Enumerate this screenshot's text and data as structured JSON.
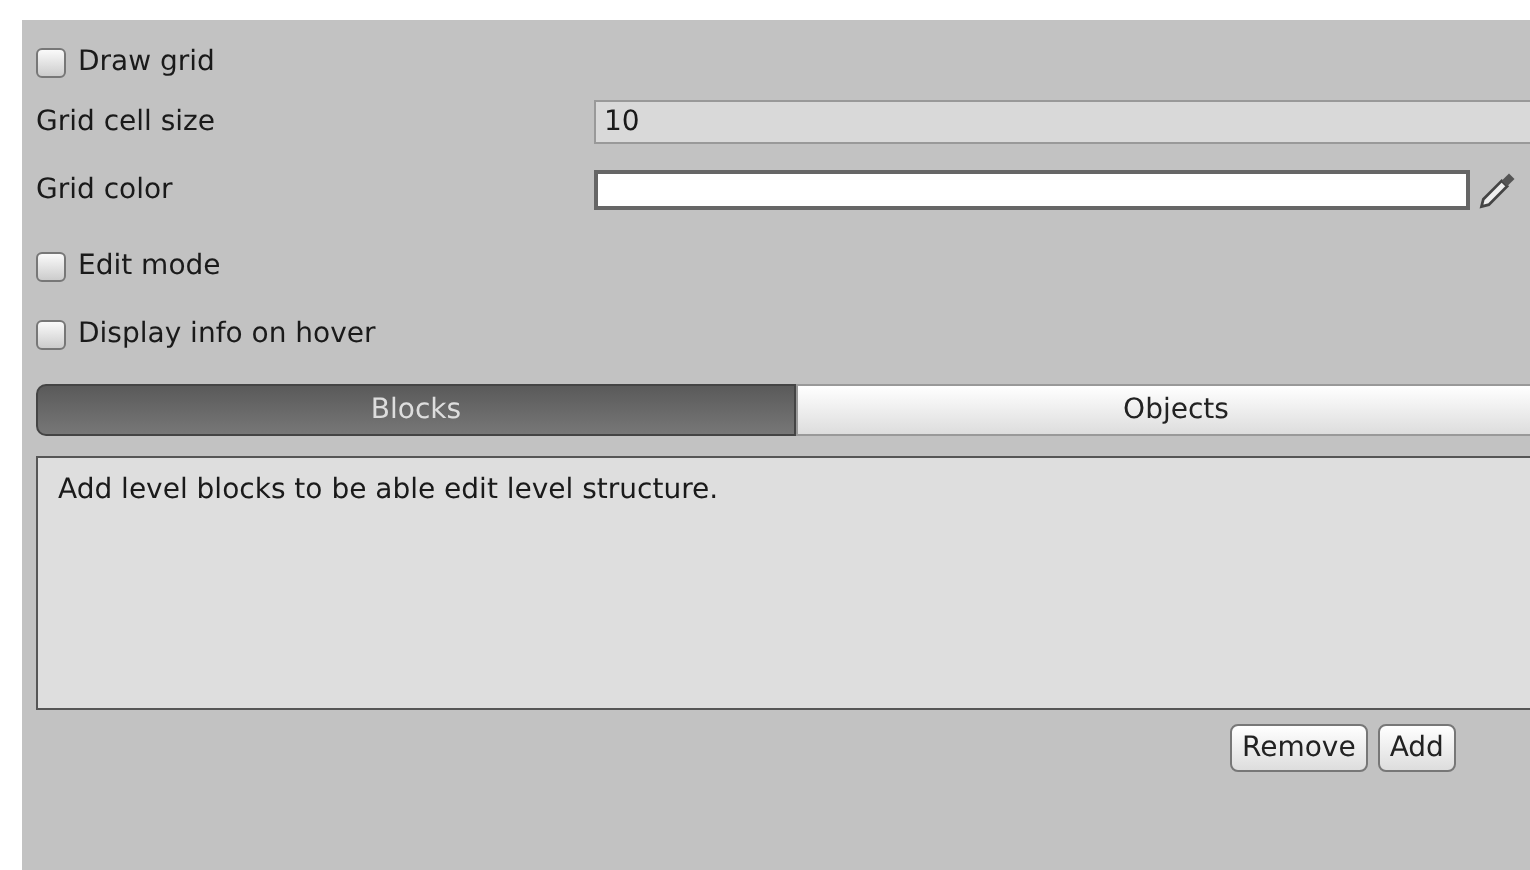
{
  "draw_grid": {
    "label": "Draw grid",
    "checked": false
  },
  "fields": [
    {
      "kind": "number",
      "label": "Grid cell size",
      "value": "10"
    },
    {
      "kind": "color",
      "label": "Grid color",
      "color": "#ffffff"
    }
  ],
  "options": [
    {
      "label": "Edit mode",
      "checked": false
    },
    {
      "label": "Display info on hover",
      "checked": false
    }
  ],
  "tabs": [
    {
      "label": "Blocks",
      "selected": true
    },
    {
      "label": "Objects",
      "selected": false
    }
  ],
  "list_message": "Add level blocks to be able edit level structure.",
  "buttons": [
    "Remove",
    "Add"
  ]
}
